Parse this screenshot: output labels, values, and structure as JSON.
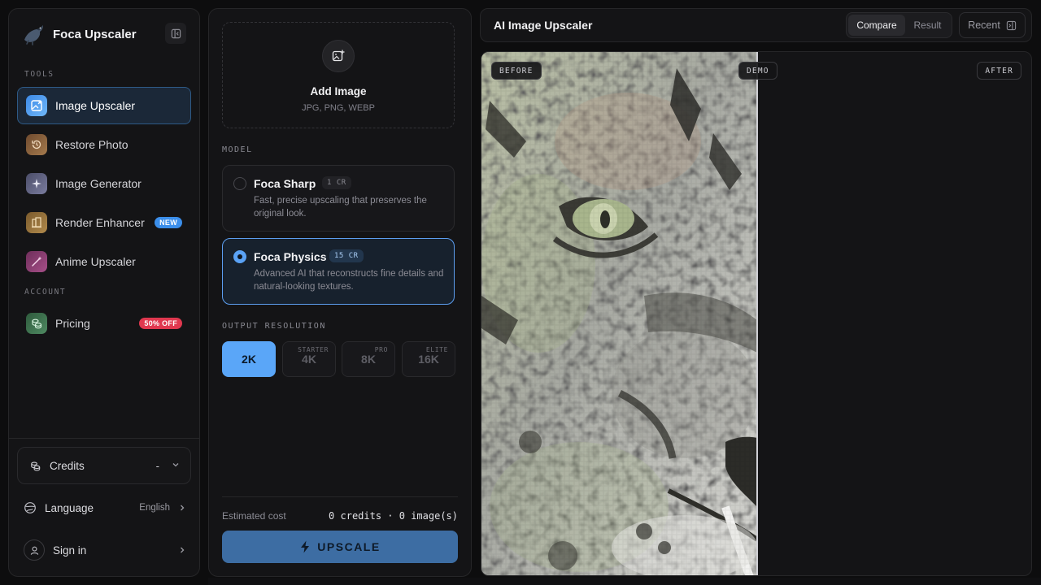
{
  "brand": {
    "name": "Foca Upscaler"
  },
  "sidebar": {
    "tools_label": "TOOLS",
    "account_label": "ACCOUNT",
    "items": [
      {
        "label": "Image Upscaler",
        "icon": "image-upscale-icon",
        "active": true
      },
      {
        "label": "Restore Photo",
        "icon": "restore-icon"
      },
      {
        "label": "Image Generator",
        "icon": "sparkle-icon"
      },
      {
        "label": "Render Enhancer",
        "icon": "building-icon",
        "badge": "NEW"
      },
      {
        "label": "Anime Upscaler",
        "icon": "wand-icon"
      }
    ],
    "pricing": {
      "label": "Pricing",
      "badge": "50% OFF"
    },
    "credits": {
      "label": "Credits",
      "value": "-"
    },
    "language": {
      "label": "Language",
      "value": "English"
    },
    "signin": {
      "label": "Sign in"
    }
  },
  "upload": {
    "title": "Add Image",
    "formats": "JPG, PNG, WEBP"
  },
  "model": {
    "label": "MODEL",
    "options": [
      {
        "name": "Foca Sharp",
        "cost": "1 CR",
        "description": "Fast, precise upscaling that preserves the original look.",
        "selected": false
      },
      {
        "name": "Foca Physics",
        "cost": "15 CR",
        "description": "Advanced AI that reconstructs fine details and natural-looking textures.",
        "selected": true
      }
    ]
  },
  "resolution": {
    "label": "OUTPUT RESOLUTION",
    "options": [
      {
        "label": "2K",
        "tier": "",
        "active": true
      },
      {
        "label": "4K",
        "tier": "STARTER"
      },
      {
        "label": "8K",
        "tier": "PRO"
      },
      {
        "label": "16K",
        "tier": "ELITE"
      }
    ]
  },
  "cost": {
    "label": "Estimated cost",
    "value": "0 credits · 0 image(s)"
  },
  "upscale_button": {
    "label": "UPSCALE"
  },
  "viewer": {
    "title": "AI Image Upscaler",
    "modes": [
      "Compare",
      "Result"
    ],
    "active_mode": "Compare",
    "recent_label": "Recent",
    "before_tag": "BEFORE",
    "demo_tag": "DEMO",
    "after_tag": "AFTER"
  },
  "colors": {
    "accent": "#5aa6f8",
    "new_badge": "#3b8eea",
    "discount_badge": "#e0384f",
    "upscale_button": "#3d6da3"
  }
}
